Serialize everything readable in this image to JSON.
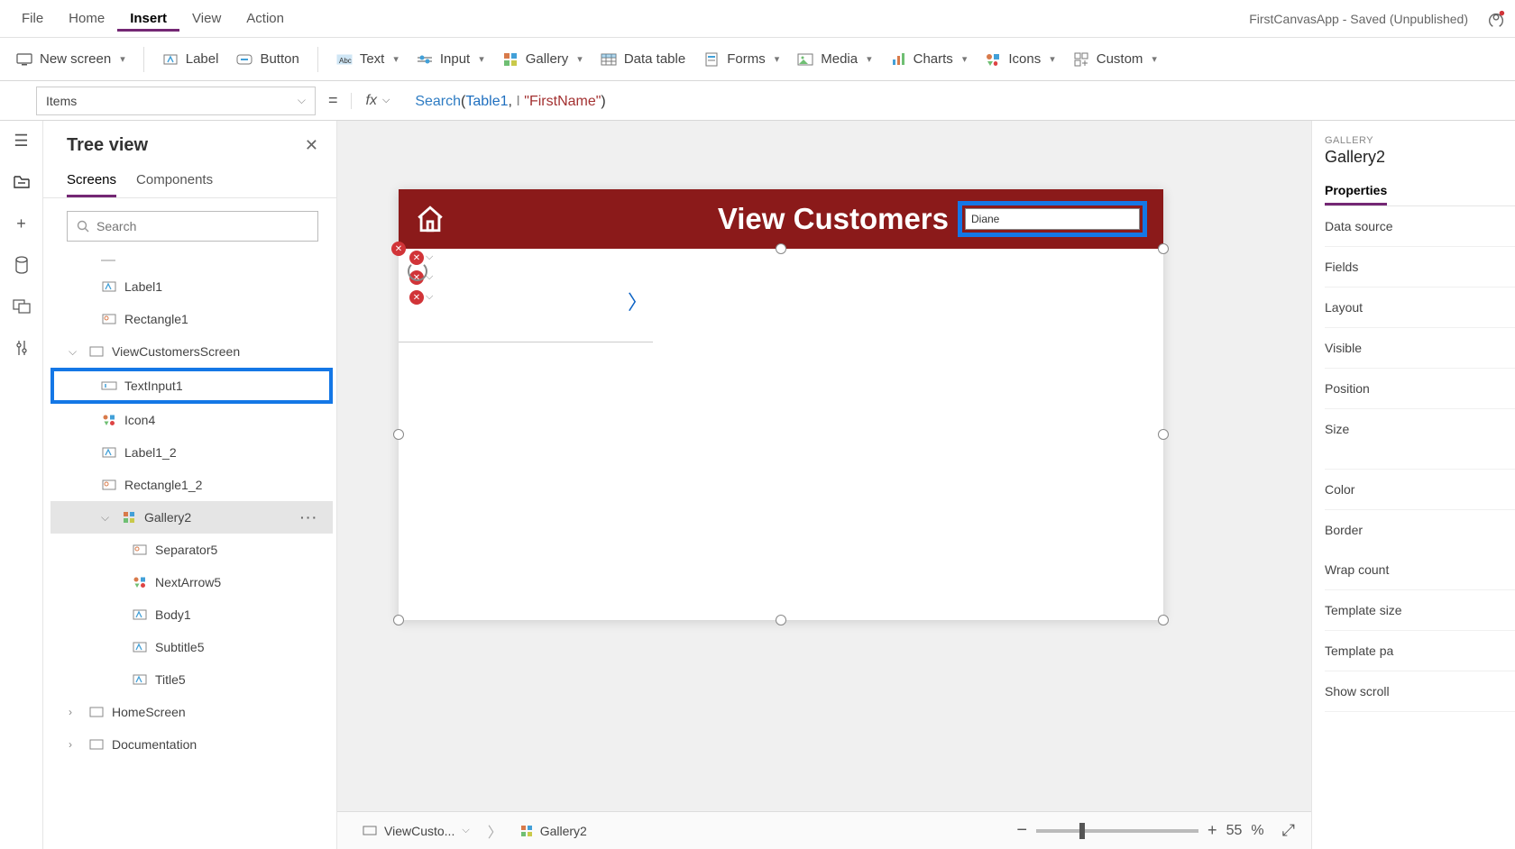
{
  "menubar": {
    "items": [
      "File",
      "Home",
      "Insert",
      "View",
      "Action"
    ],
    "active_index": 2,
    "app_title": "FirstCanvasApp - Saved (Unpublished)"
  },
  "ribbon": {
    "new_screen": "New screen",
    "label": "Label",
    "button": "Button",
    "text": "Text",
    "input": "Input",
    "gallery": "Gallery",
    "data_table": "Data table",
    "forms": "Forms",
    "media": "Media",
    "charts": "Charts",
    "icons": "Icons",
    "custom": "Custom"
  },
  "formula": {
    "property": "Items",
    "fx": "fx",
    "tokens": {
      "fn": "Search",
      "open": "(",
      "id": "Table1",
      "comma": ", ",
      "str": "\"FirstName\"",
      "close": ")"
    }
  },
  "tree": {
    "title": "Tree view",
    "tabs": [
      "Screens",
      "Components"
    ],
    "active_tab": 0,
    "search_placeholder": "Search",
    "nodes": [
      {
        "depth": 1,
        "label": "Label1",
        "icon": "label"
      },
      {
        "depth": 1,
        "label": "Rectangle1",
        "icon": "rect"
      },
      {
        "depth": 0,
        "label": "ViewCustomersScreen",
        "icon": "screen",
        "expanded": true
      },
      {
        "depth": 1,
        "label": "TextInput1",
        "icon": "input",
        "highlight": true
      },
      {
        "depth": 1,
        "label": "Icon4",
        "icon": "icons"
      },
      {
        "depth": 1,
        "label": "Label1_2",
        "icon": "label"
      },
      {
        "depth": 1,
        "label": "Rectangle1_2",
        "icon": "rect"
      },
      {
        "depth": 1,
        "label": "Gallery2",
        "icon": "gallery",
        "expanded": true,
        "selected": true,
        "more": true
      },
      {
        "depth": 2,
        "label": "Separator5",
        "icon": "rect"
      },
      {
        "depth": 2,
        "label": "NextArrow5",
        "icon": "icons"
      },
      {
        "depth": 2,
        "label": "Body1",
        "icon": "label"
      },
      {
        "depth": 2,
        "label": "Subtitle5",
        "icon": "label"
      },
      {
        "depth": 2,
        "label": "Title5",
        "icon": "label"
      },
      {
        "depth": 0,
        "label": "HomeScreen",
        "icon": "screen",
        "expanded": false
      },
      {
        "depth": 0,
        "label": "Documentation",
        "icon": "screen",
        "expanded": false
      }
    ]
  },
  "canvas": {
    "header_title": "View Customers",
    "search_value": "Diane"
  },
  "breadcrumb": {
    "screen": "ViewCusto...",
    "control": "Gallery2",
    "zoom_value": "55",
    "zoom_pct": "%"
  },
  "props": {
    "category": "GALLERY",
    "name": "Gallery2",
    "tab_active": "Properties",
    "rows": [
      "Data source",
      "Fields",
      "Layout",
      "Visible",
      "Position",
      "Size",
      "Color",
      "Border",
      "Wrap count",
      "Template size",
      "Template pa",
      "Show scroll"
    ]
  },
  "colors": {
    "accent": "#742774",
    "highlight": "#1477e6",
    "header_bg": "#8b1a1a"
  }
}
